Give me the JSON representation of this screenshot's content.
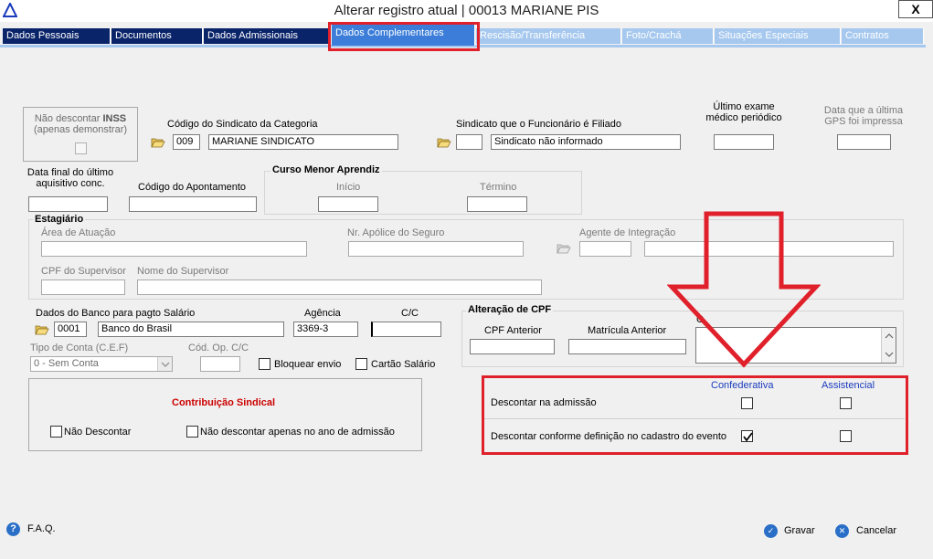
{
  "window": {
    "title": "Alterar registro atual | 00013 MARIANE PIS",
    "close_label": "X"
  },
  "tabs": [
    {
      "label": "Dados Pessoais",
      "key": "D"
    },
    {
      "label": "Documentos",
      "key": "D"
    },
    {
      "label": "Dados Admissionais",
      "key": "A"
    },
    {
      "label": "Dados Complementares",
      "key": ""
    },
    {
      "label": "Rescisão/Transferência",
      "key": "R"
    },
    {
      "label": "Foto/Crachá",
      "key": "F"
    },
    {
      "label": "Situações Especiais",
      "key": "S"
    },
    {
      "label": "Contratos",
      "key": "C"
    }
  ],
  "inss": {
    "line1": "Não descontar ",
    "bold": "INSS",
    "line2": "(apenas demonstrar)"
  },
  "sindicato_categoria": {
    "label": "Código do Sindicato da Categoria",
    "code": "009",
    "name": "MARIANE SINDICATO"
  },
  "sindicato_filiado": {
    "label": "Sindicato que o Funcionário é Filiado",
    "code": "",
    "name": "Sindicato não informado"
  },
  "ultimo_exame": {
    "label": "Último exame médico periódico",
    "value": ""
  },
  "gps": {
    "label": "Data que a última GPS foi impressa",
    "value": ""
  },
  "data_final": {
    "label": "Data final do último aquisitivo conc.",
    "value": ""
  },
  "apontamento": {
    "label": "Código do Apontamento",
    "value": ""
  },
  "menor_aprendiz": {
    "title": "Curso Menor Aprendiz",
    "inicio_label": "Início",
    "termino_label": "Término"
  },
  "estagiario": {
    "title": "Estagiário",
    "area_label": "Área de Atuação",
    "apolice_label": "Nr. Apólice do Seguro",
    "agente_label": "Agente de Integração",
    "cpf_sup_label": "CPF do Supervisor",
    "nome_sup_label": "Nome do Supervisor"
  },
  "banco": {
    "label": "Dados do Banco para pagto Salário",
    "code": "0001",
    "name": "Banco do Brasil",
    "agencia_label": "Agência",
    "agencia": "3369-3",
    "cc_label": "C/C",
    "cc": "",
    "tipo_conta_label": "Tipo de Conta (C.E.F)",
    "tipo_conta": "0 - Sem Conta",
    "cod_op_label": "Cód. Op. C/C",
    "bloquear_label": "Bloquear envio",
    "cartao_label": "Cartão Salário"
  },
  "alteracao_cpf": {
    "title": "Alteração de CPF",
    "cpf_anterior_label": "CPF Anterior",
    "matricula_label": "Matrícula Anterior",
    "partial_label": "C"
  },
  "contribuicao": {
    "title": "Contribuição Sindical",
    "nao_descontar_label": "Não Descontar",
    "nao_desc_admissao_label": "Não descontar apenas no ano de admissão"
  },
  "descontos": {
    "col_confederativa": "Confederativa",
    "col_assistencial": "Assistencial",
    "row1_label": "Descontar na admissão",
    "row2_label": "Descontar conforme definição no cadastro do evento",
    "row1": {
      "confederativa": false,
      "assistencial": false
    },
    "row2": {
      "confederativa": true,
      "assistencial": false
    }
  },
  "footer": {
    "faq_label": "F.A.Q.",
    "gravar_label": "Gravar",
    "cancelar_label": "Cancelar"
  },
  "colors": {
    "tab_dark": "#0a246a",
    "tab_light": "#a6c8ee",
    "tab_active": "#3b7dd8",
    "highlight": "#e0202a",
    "accent_blue": "#1a3bbd",
    "title_red": "#cc0000"
  }
}
